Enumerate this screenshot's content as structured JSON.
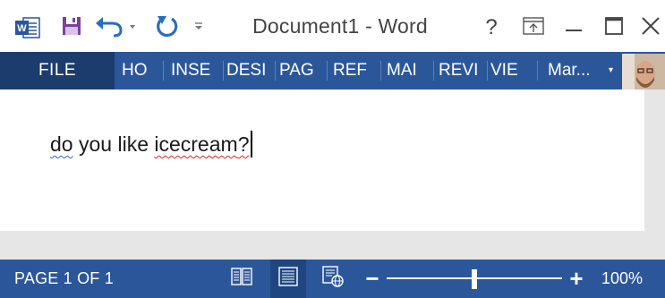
{
  "window": {
    "title": "Document1 - Word",
    "help_label": "?"
  },
  "quick_access": {
    "app_icon": "word-logo-icon",
    "save_icon": "save-icon",
    "undo_icon": "undo-icon",
    "redo_icon": "redo-icon",
    "customize_icon": "customize-qat-icon"
  },
  "ribbon": {
    "file_label": "FILE",
    "tabs": [
      {
        "label": "HO"
      },
      {
        "label": "INSE"
      },
      {
        "label": "DESI"
      },
      {
        "label": "PAG"
      },
      {
        "label": "REF"
      },
      {
        "label": "MAI"
      },
      {
        "label": "REVI"
      },
      {
        "label": "VIE"
      }
    ],
    "user_name": "Mar...",
    "user_caret": "▾"
  },
  "document": {
    "words": [
      "do",
      "you",
      "like",
      "icecream?"
    ],
    "spelling_flag_word": "icecream",
    "trailing": "?"
  },
  "status": {
    "page_info": "PAGE 1 OF 1",
    "zoom_out": "−",
    "zoom_in": "+",
    "zoom_level": "100%",
    "zoom_fraction": 0.5
  },
  "colors": {
    "accent": "#2b579a",
    "file_tab": "#1c3c6e",
    "spell_error": "#e02020",
    "grammar_hint": "#3a5fd8",
    "word_logo": "#2b579a",
    "save_icon": "#7a3fa0",
    "undo_redo": "#2a6ebb"
  }
}
